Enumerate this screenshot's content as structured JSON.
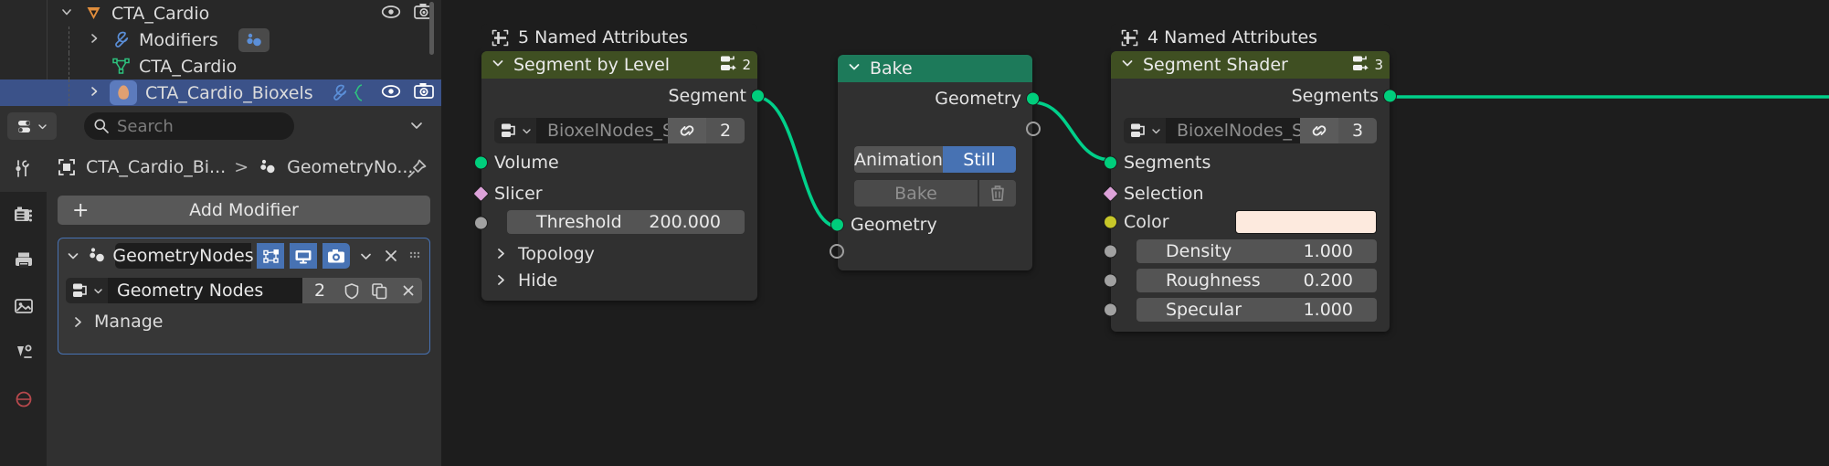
{
  "app": "Blender",
  "outliner": {
    "rows": [
      {
        "label": "CTA_Cardio",
        "icon": "cone-object-icon",
        "expanded": true,
        "indent": 62,
        "selected": false,
        "has_visibility": true
      },
      {
        "label": "Modifiers",
        "icon": "wrench-icon",
        "expanded": false,
        "indent": 92,
        "selected": false,
        "has_visibility": false
      },
      {
        "label": "CTA_Cardio",
        "icon": "mesh-data-icon",
        "expanded": null,
        "indent": 122,
        "selected": false,
        "has_visibility": false
      },
      {
        "label": "CTA_Cardio_Bioxels",
        "icon": "volume-object-icon",
        "expanded": false,
        "indent": 92,
        "selected": true,
        "has_visibility": true
      }
    ],
    "visibility_icons": [
      "eye-icon",
      "camera-icon"
    ]
  },
  "properties_header": {
    "editor_type": "properties-editor-icon",
    "search_placeholder": "Search",
    "filter_chevron": "chevron-down-icon"
  },
  "tabs": [
    {
      "name": "tool-tab",
      "icon": "tool-icon",
      "active": true
    },
    {
      "name": "render-tab",
      "icon": "render-camera-icon",
      "active": false
    },
    {
      "name": "output-tab",
      "icon": "printer-icon",
      "active": false
    },
    {
      "name": "view-layer-tab",
      "icon": "images-icon",
      "active": false
    },
    {
      "name": "scene-tab",
      "icon": "scene-cone-icon",
      "active": false
    },
    {
      "name": "world-tab",
      "icon": "world-icon",
      "active": false
    }
  ],
  "breadcrumb": {
    "object": "CTA_Cardio_Bi...",
    "separator": ">",
    "modifier": "GeometryNo...",
    "pin": "pin-icon"
  },
  "modifier_panel": {
    "add_modifier_label": "Add Modifier",
    "add_modifier_plus": "+",
    "name": "GeometryNodes",
    "toggles": [
      "edit-mode-display-icon",
      "realtime-display-icon",
      "render-display-icon"
    ],
    "dropdown_caret": "chevron-down-icon",
    "close": "×",
    "drag_handle": "drag-dots-icon",
    "node_group_name": "Geometry Nodes",
    "node_group_users": "2",
    "node_group_shield": "shield-fake-user-icon",
    "node_group_copy": "duplicate-icon",
    "node_group_unlink": "×",
    "manage_label": "Manage",
    "manage_caret": ">"
  },
  "nodes": [
    {
      "id": "segment-by-level",
      "banner": "5 Named Attributes",
      "banner_icon": "named-attributes-icon",
      "title": "Segment by Level",
      "header_color": "#3f4f22",
      "caret": "⌄",
      "node_group_badge": "2",
      "outputs": [
        {
          "label": "Segment",
          "socket": "geometry",
          "color": "#00ce7c"
        }
      ],
      "id_field": {
        "icon": "node-group-icon",
        "name": "BioxelNodes_Se...",
        "link_icon": "link-icon",
        "count": "2"
      },
      "inputs": [
        {
          "label": "Volume",
          "socket": "geometry",
          "color": "#00ce7c",
          "connected": true
        },
        {
          "label": "Slicer",
          "socket": "geometry-field",
          "color": "#dda2d9",
          "shape": "diamond"
        },
        {
          "label": "Threshold",
          "value": "200.000",
          "socket": "value",
          "color": "#a1a1a1",
          "is_slider": true
        }
      ],
      "panels": [
        {
          "label": "Topology",
          "caret": ">"
        },
        {
          "label": "Hide",
          "caret": ">"
        }
      ]
    },
    {
      "id": "bake",
      "title": "Bake",
      "header_color": "#1d7a5a",
      "caret": "⌄",
      "outputs": [
        {
          "label": "Geometry",
          "socket": "geometry",
          "color": "#00ce7c"
        },
        {
          "label": "",
          "socket": "extend",
          "color": "transparent"
        }
      ],
      "mode_toggle": {
        "options": [
          "Animation",
          "Still"
        ],
        "selected": "Still"
      },
      "bake_button": {
        "label": "Bake",
        "trash_icon": "trash-icon"
      },
      "inputs": [
        {
          "label": "Geometry",
          "socket": "geometry",
          "color": "#00ce7c",
          "connected": true
        },
        {
          "label": "",
          "socket": "extend",
          "color": "transparent"
        }
      ]
    },
    {
      "id": "segment-shader",
      "banner": "4 Named Attributes",
      "banner_icon": "named-attributes-icon",
      "title": "Segment Shader",
      "header_color": "#3f4f22",
      "caret": "⌄",
      "node_group_badge": "3",
      "outputs": [
        {
          "label": "Segments",
          "socket": "geometry",
          "color": "#00ce7c"
        }
      ],
      "id_field": {
        "icon": "node-group-icon",
        "name": "BioxelNodes_Se...",
        "link_icon": "link-icon",
        "count": "3"
      },
      "inputs": [
        {
          "label": "Segments",
          "socket": "geometry",
          "color": "#00ce7c",
          "connected": true
        },
        {
          "label": "Selection",
          "socket": "geometry-field",
          "color": "#dda2d9",
          "shape": "diamond"
        },
        {
          "label": "Color",
          "socket": "color",
          "color": "#c7c729",
          "swatch": "#fdeade"
        },
        {
          "label": "Density",
          "value": "1.000",
          "socket": "value",
          "color": "#a1a1a1",
          "is_slider": true
        },
        {
          "label": "Roughness",
          "value": "0.200",
          "socket": "value",
          "color": "#a1a1a1",
          "is_slider": true
        },
        {
          "label": "Specular",
          "value": "1.000",
          "socket": "value",
          "color": "#a1a1a1",
          "is_slider": true
        }
      ]
    }
  ],
  "colors": {
    "link_green": "#00d08a",
    "selection_blue": "#3b5289",
    "accent_blue": "#4772b3",
    "node_group_header": "#3f4f22",
    "bake_header": "#1d7a5a"
  }
}
